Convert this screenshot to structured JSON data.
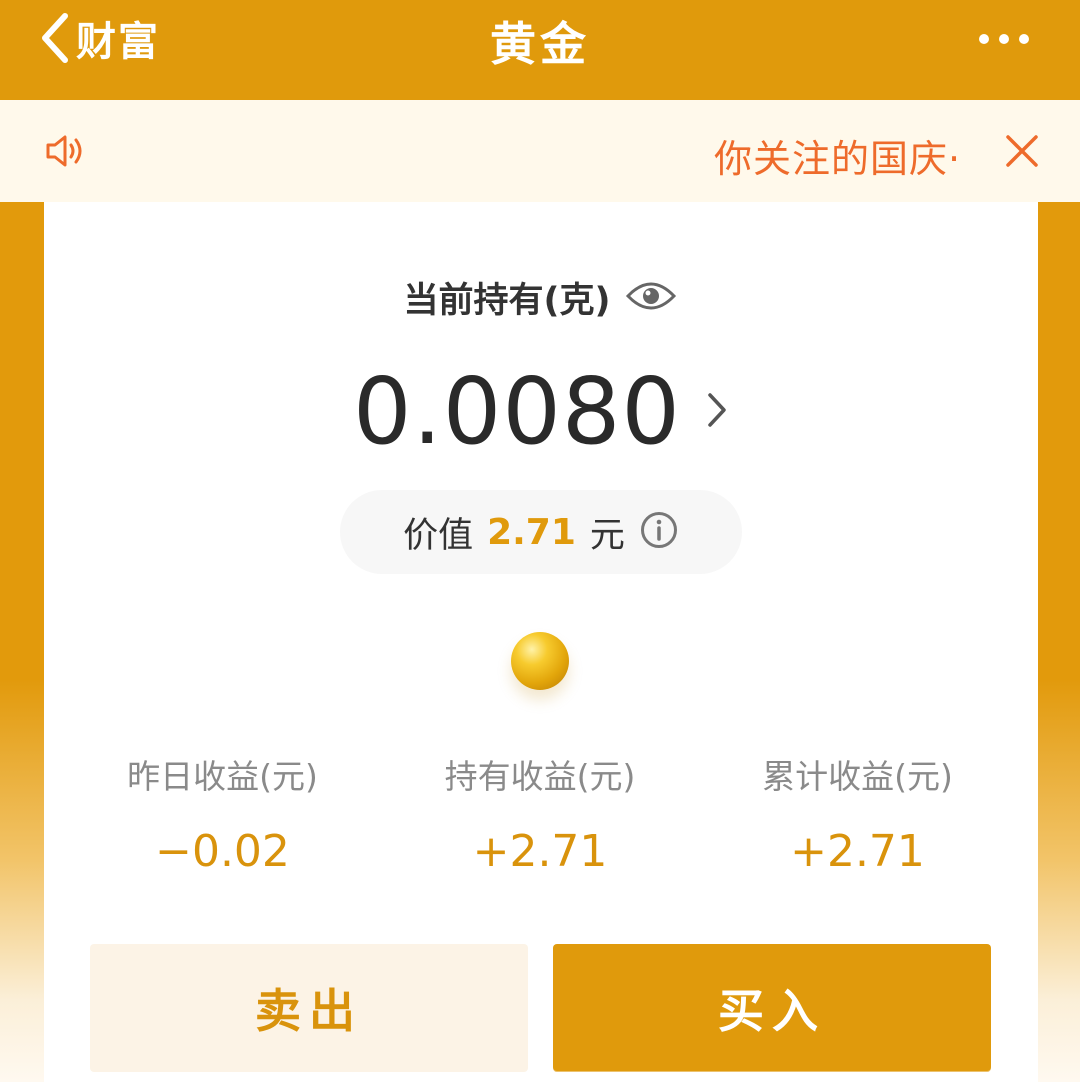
{
  "colors": {
    "brand": "#E09A0C",
    "notice_bg": "#FFF9EB",
    "notice_text": "#EE6B2B",
    "value_accent": "#D9930C"
  },
  "header": {
    "back_label": "财富",
    "title": "黄金",
    "back_icon": "chevron-left-icon",
    "more_icon": "more-dots-icon"
  },
  "notice": {
    "text": "你关注的国庆·",
    "speaker_icon": "speaker-icon",
    "close_icon": "close-icon"
  },
  "holding": {
    "label": "当前持有(克)",
    "visibility_icon": "eye-icon",
    "amount": "0.0080",
    "arrow_icon": "chevron-right-icon",
    "value_label": "价值",
    "value": "2.71",
    "value_unit": "元",
    "info_icon": "info-icon"
  },
  "stats": [
    {
      "label": "昨日收益(元)",
      "value": "−0.02"
    },
    {
      "label": "持有收益(元)",
      "value": "+2.71"
    },
    {
      "label": "累计收益(元)",
      "value": "+2.71"
    }
  ],
  "actions": {
    "sell_label": "卖出",
    "buy_label": "买入"
  }
}
